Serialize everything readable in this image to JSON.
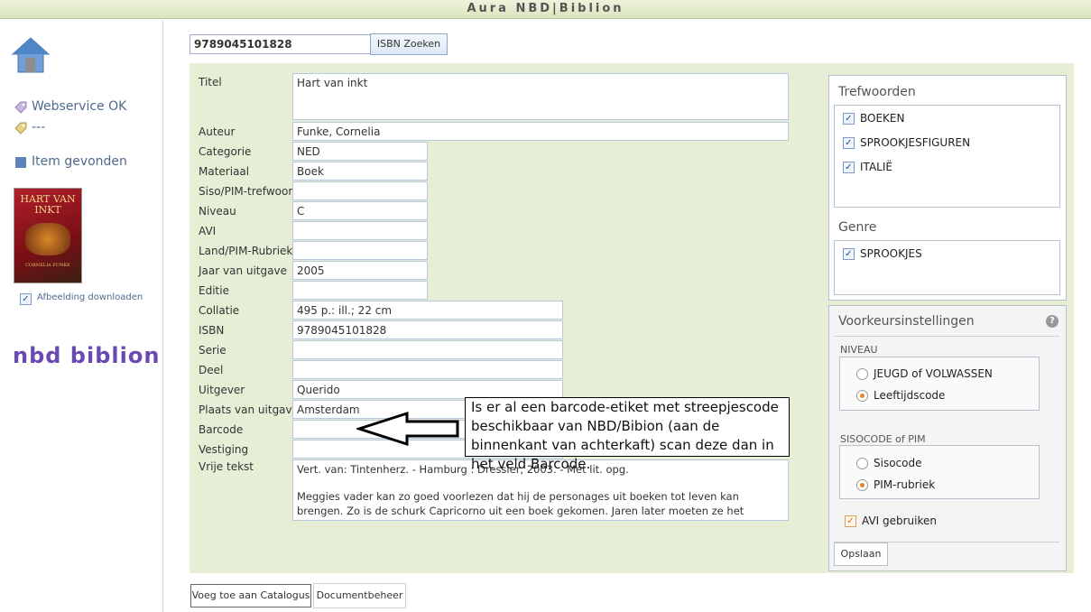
{
  "app": {
    "title": "Aura NBD|Biblion"
  },
  "sidebar": {
    "status_webservice": "Webservice OK",
    "status_second": "---",
    "status_item": "Item gevonden",
    "download_image_label": "Afbeelding downloaden",
    "download_image_checked": true,
    "logo_text": "nbd biblion",
    "cover_title": "HART VAN INKT",
    "cover_author": "CORNELIA FUNKE"
  },
  "search": {
    "value": "9789045101828",
    "button_label": "ISBN Zoeken"
  },
  "form": {
    "fields": [
      {
        "label": "Titel",
        "value": "Hart van inkt"
      },
      {
        "label": "Auteur",
        "value": "Funke, Cornelia"
      },
      {
        "label": "Categorie",
        "value": "NED"
      },
      {
        "label": "Materiaal",
        "value": "Boek"
      },
      {
        "label": "Siso/PIM-trefwoord",
        "value": ""
      },
      {
        "label": "Niveau",
        "value": "C"
      },
      {
        "label": "AVI",
        "value": ""
      },
      {
        "label": "Land/PIM-Rubriek",
        "value": ""
      },
      {
        "label": "Jaar van uitgave",
        "value": "2005"
      },
      {
        "label": "Editie",
        "value": ""
      },
      {
        "label": "Collatie",
        "value": "495 p.: ill.; 22 cm"
      },
      {
        "label": "ISBN",
        "value": "9789045101828"
      },
      {
        "label": "Serie",
        "value": ""
      },
      {
        "label": "Deel",
        "value": ""
      },
      {
        "label": "Uitgever",
        "value": "Querido"
      },
      {
        "label": "Plaats van uitgave",
        "value": "Amsterdam"
      },
      {
        "label": "Barcode",
        "value": ""
      },
      {
        "label": "Vestiging",
        "value": ""
      },
      {
        "label": "Vrije tekst",
        "value_line1": "Vert. van: Tintenherz. - Hamburg : Dressler, 2003. - Met lit. opg.",
        "value_line2": "Meggies vader kan zo goed voorlezen dat hij de personages uit boeken tot leven kan brengen. Zo is de schurk Capricorno uit een boek gekomen. Jaren later moeten ze het opnieuw tegen hem opnemen."
      }
    ]
  },
  "callout": {
    "text": "Is er al een barcode-etiket met streepjescode beschikbaar van NBD/Bibion (aan de binnenkant van achterkaft) scan deze dan in het veld Barcode."
  },
  "trefwoorden": {
    "title": "Trefwoorden",
    "items": [
      {
        "label": "BOEKEN",
        "checked": true
      },
      {
        "label": "SPROOKJESFIGUREN",
        "checked": true
      },
      {
        "label": "ITALIË",
        "checked": true
      }
    ]
  },
  "genre": {
    "title": "Genre",
    "items": [
      {
        "label": "SPROOKJES",
        "checked": true
      }
    ]
  },
  "voorkeur": {
    "title": "Voorkeursinstellingen",
    "niveau_title": "NIVEAU",
    "niveau_options": [
      {
        "label": "JEUGD of VOLWASSEN",
        "selected": false
      },
      {
        "label": "Leeftijdscode",
        "selected": true
      }
    ],
    "siso_title": "SISOCODE of PIM",
    "siso_options": [
      {
        "label": "Sisocode",
        "selected": false
      },
      {
        "label": "PIM-rubriek",
        "selected": true
      }
    ],
    "avi_label": "AVI gebruiken",
    "avi_checked": true,
    "save_label": "Opslaan"
  },
  "bottom": {
    "add_catalog_label": "Voeg toe aan Catalogus",
    "document_label": "Documentbeheer"
  },
  "colors": {
    "panel": "#e6efd6",
    "accent": "#e8862a",
    "link": "#4f6a8c"
  }
}
